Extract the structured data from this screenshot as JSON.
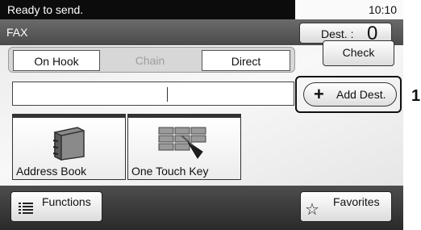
{
  "status": {
    "message": "Ready to send.",
    "time": "10:10"
  },
  "mode": {
    "title": "FAX"
  },
  "destination": {
    "label": "Dest. :",
    "count": "0"
  },
  "tabs": [
    {
      "label": "On Hook",
      "state": "active"
    },
    {
      "label": "Chain",
      "state": "disabled"
    },
    {
      "label": "Direct",
      "state": "active"
    }
  ],
  "buttons": {
    "check": "Check",
    "add_dest": "Add Dest.",
    "functions": "Functions",
    "favorites": "Favorites"
  },
  "tiles": [
    {
      "label": "Address Book",
      "icon": "address-book-icon"
    },
    {
      "label": "One Touch Key",
      "icon": "one-touch-key-icon"
    }
  ],
  "annotation": {
    "callout_number": "1"
  }
}
